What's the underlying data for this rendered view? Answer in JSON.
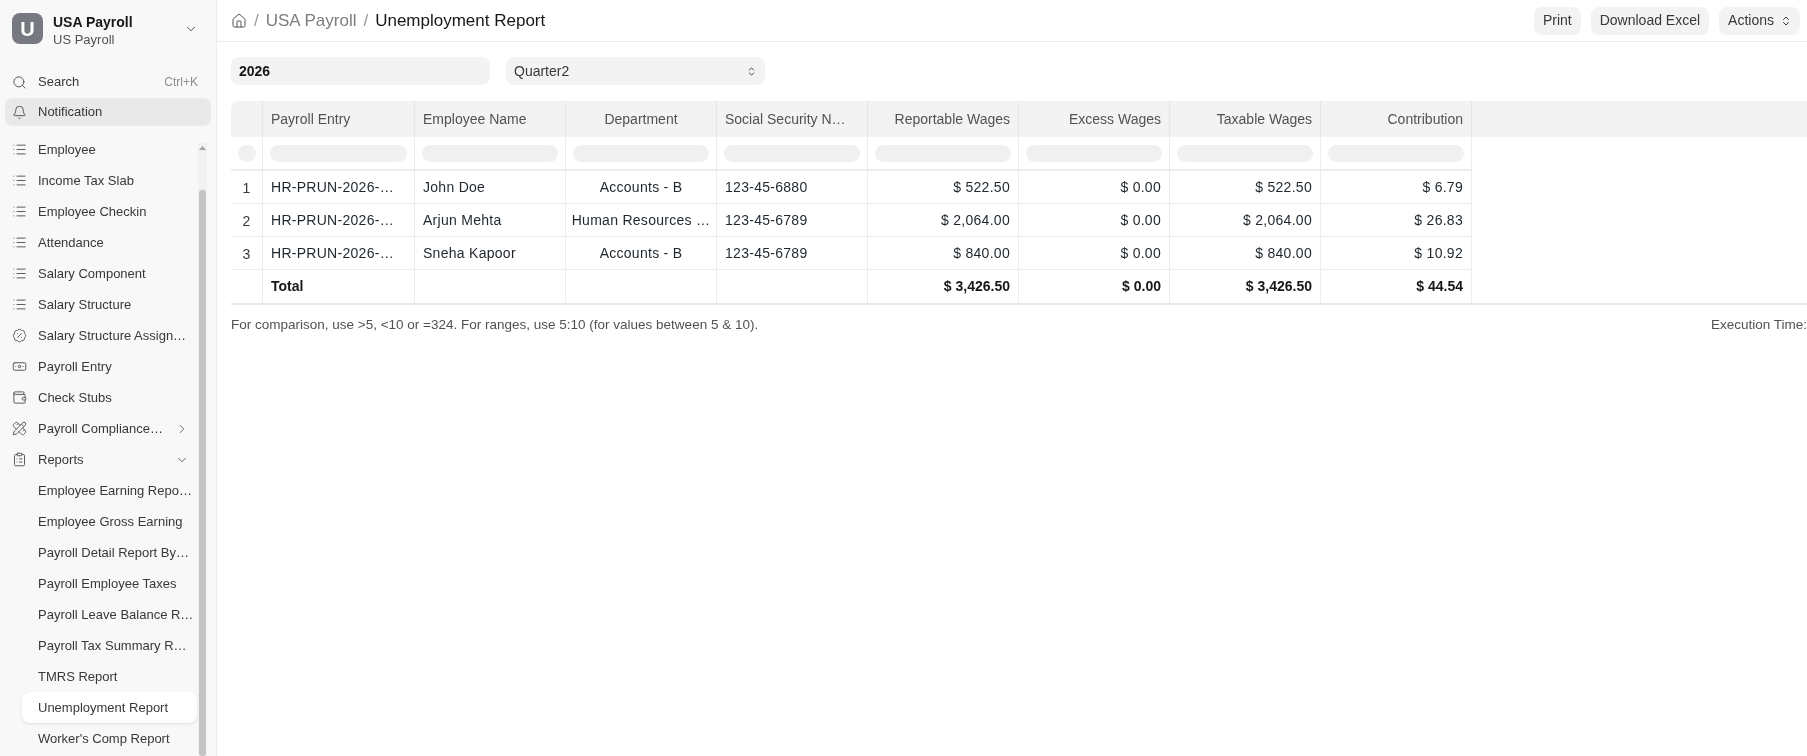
{
  "sidebar": {
    "workspace": {
      "initial": "U",
      "title": "USA Payroll",
      "subtitle": "US Payroll"
    },
    "search": {
      "label": "Search",
      "shortcut": "Ctrl+K"
    },
    "notification": {
      "label": "Notification",
      "hovered": true
    },
    "items": [
      {
        "label": "Employee",
        "kind": "list"
      },
      {
        "label": "Income Tax Slab",
        "kind": "list"
      },
      {
        "label": "Employee Checkin",
        "kind": "list"
      },
      {
        "label": "Attendance",
        "kind": "list"
      },
      {
        "label": "Salary Component",
        "kind": "list"
      },
      {
        "label": "Salary Structure",
        "kind": "list"
      },
      {
        "label": "Salary Structure Assign…",
        "kind": "assignment"
      },
      {
        "label": "Payroll Entry",
        "kind": "entry"
      },
      {
        "label": "Check Stubs",
        "kind": "stubs"
      },
      {
        "label": "Payroll Compliance…",
        "kind": "compliance",
        "expanded": false
      },
      {
        "label": "Reports",
        "kind": "reports",
        "expanded": true,
        "children": [
          {
            "label": "Employee Earning Repo…",
            "selected": false
          },
          {
            "label": "Employee Gross Earning",
            "selected": false
          },
          {
            "label": "Payroll Detail Report By…",
            "selected": false
          },
          {
            "label": "Payroll Employee Taxes",
            "selected": false
          },
          {
            "label": "Payroll Leave Balance R…",
            "selected": false
          },
          {
            "label": "Payroll Tax Summary R…",
            "selected": false
          },
          {
            "label": "TMRS Report",
            "selected": false
          },
          {
            "label": "Unemployment Report",
            "selected": true
          },
          {
            "label": "Worker's Comp Report",
            "selected": false
          }
        ]
      }
    ]
  },
  "header": {
    "breadcrumbs": [
      {
        "separator": "/",
        "label": "USA Payroll",
        "current": false
      },
      {
        "separator": "/",
        "label": "Unemployment Report",
        "current": true
      }
    ],
    "actions": [
      {
        "label": "Print",
        "kind": "button"
      },
      {
        "label": "Download Excel",
        "kind": "button"
      },
      {
        "label": "Actions",
        "kind": "menu"
      }
    ]
  },
  "filters": [
    {
      "kind": "input",
      "value": "2026"
    },
    {
      "kind": "select",
      "value": "Quarter2"
    }
  ],
  "table": {
    "columns": [
      {
        "label": "Payroll Entry",
        "kind": "text"
      },
      {
        "label": "Employee Name",
        "kind": "text"
      },
      {
        "label": "Department",
        "kind": "category"
      },
      {
        "label": "Social Security N…",
        "kind": "text"
      },
      {
        "label": "Reportable Wages",
        "kind": "currency"
      },
      {
        "label": "Excess Wages",
        "kind": "currency"
      },
      {
        "label": "Taxable Wages",
        "kind": "currency"
      },
      {
        "label": "Contribution",
        "kind": "currency"
      }
    ],
    "rows": [
      {
        "index": "1",
        "cells": [
          "HR-PRUN-2026-…",
          "John Doe",
          "Accounts - B",
          "123-45-6880",
          "$ 522.50",
          "$ 0.00",
          "$ 522.50",
          "$ 6.79"
        ]
      },
      {
        "index": "2",
        "cells": [
          "HR-PRUN-2026-…",
          "Arjun Mehta",
          "Human Resources …",
          "123-45-6789",
          "$ 2,064.00",
          "$ 0.00",
          "$ 2,064.00",
          "$ 26.83"
        ]
      },
      {
        "index": "3",
        "cells": [
          "HR-PRUN-2026-…",
          "Sneha Kapoor",
          "Accounts - B",
          "123-45-6789",
          "$ 840.00",
          "$ 0.00",
          "$ 840.00",
          "$ 10.92"
        ]
      }
    ],
    "total": {
      "label": "Total",
      "values": [
        "$ 3,426.50",
        "$ 0.00",
        "$ 3,426.50",
        "$ 44.54"
      ]
    }
  },
  "footer": {
    "hint": "For comparison, use >5, <10 or =324. For ranges, use 5:10 (for values between 5 & 10).",
    "execution_time": "Execution Time:"
  }
}
